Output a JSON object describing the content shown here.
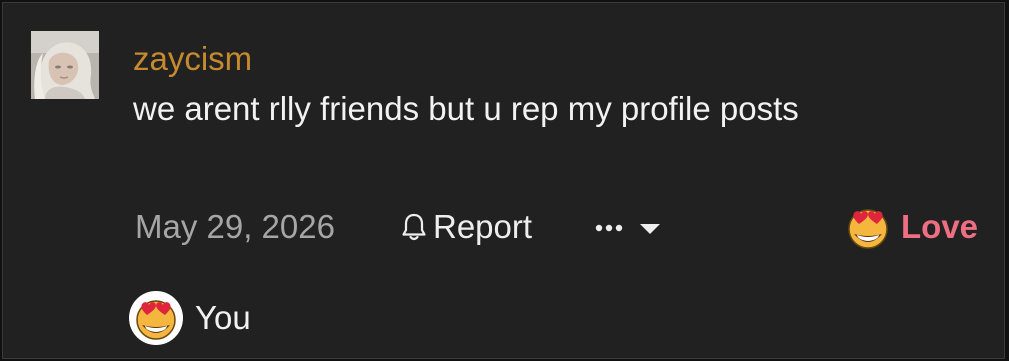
{
  "post": {
    "username": "zaycism",
    "message": "we arent rlly friends but u rep my profile posts",
    "date": "May 29, 2026"
  },
  "actions": {
    "report_label": "Report",
    "more_icon": "ellipsis-dropdown-icon",
    "reaction_icon": "heart-eyes-icon",
    "reaction_label": "Love",
    "reaction_color": "#ee6e82"
  },
  "reactions": {
    "icon": "heart-eyes-icon",
    "users": "You"
  },
  "colors": {
    "background": "#212121",
    "username": "#c68a2e",
    "text": "#f2f2f2",
    "muted": "#a6a6a6"
  }
}
